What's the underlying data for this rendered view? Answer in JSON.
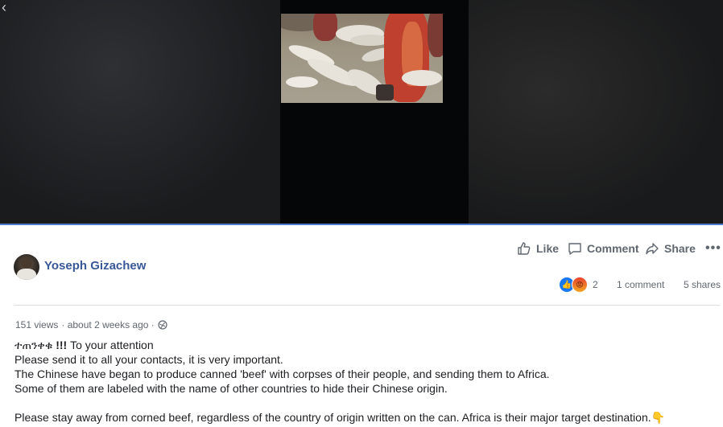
{
  "video": {
    "back_icon": "chevron-left-icon"
  },
  "post": {
    "author": "Yoseph Gizachew",
    "actions": {
      "like": "Like",
      "comment": "Comment",
      "share": "Share",
      "more": "•••"
    },
    "reactions": {
      "count": "2",
      "comments": "1 comment",
      "shares": "5 shares"
    },
    "meta": {
      "views": "151 views",
      "time": "· about 2 weeks ago ·",
      "privacy_icon": "globe-icon"
    },
    "body": {
      "line1_amharic": "ተጠንቀቁ",
      "line1_bold": "!!!",
      "line1_rest": " To your attention",
      "line2": "Please send it to all your contacts, it is very important.",
      "line3": "The Chinese have began to produce canned 'beef' with corpses of their people, and sending them to Africa.",
      "line4": "Some of them are labeled with the name of other countries to hide their Chinese origin.",
      "line5": "Please stay away from corned beef, regardless of the country of origin written on the can. Africa is their major target destination.",
      "line5_emoji": "👇"
    }
  },
  "colors": {
    "author_link": "#385898",
    "muted_text": "#606770",
    "like_blue": "#1877f2",
    "divider": "#dadde1"
  }
}
